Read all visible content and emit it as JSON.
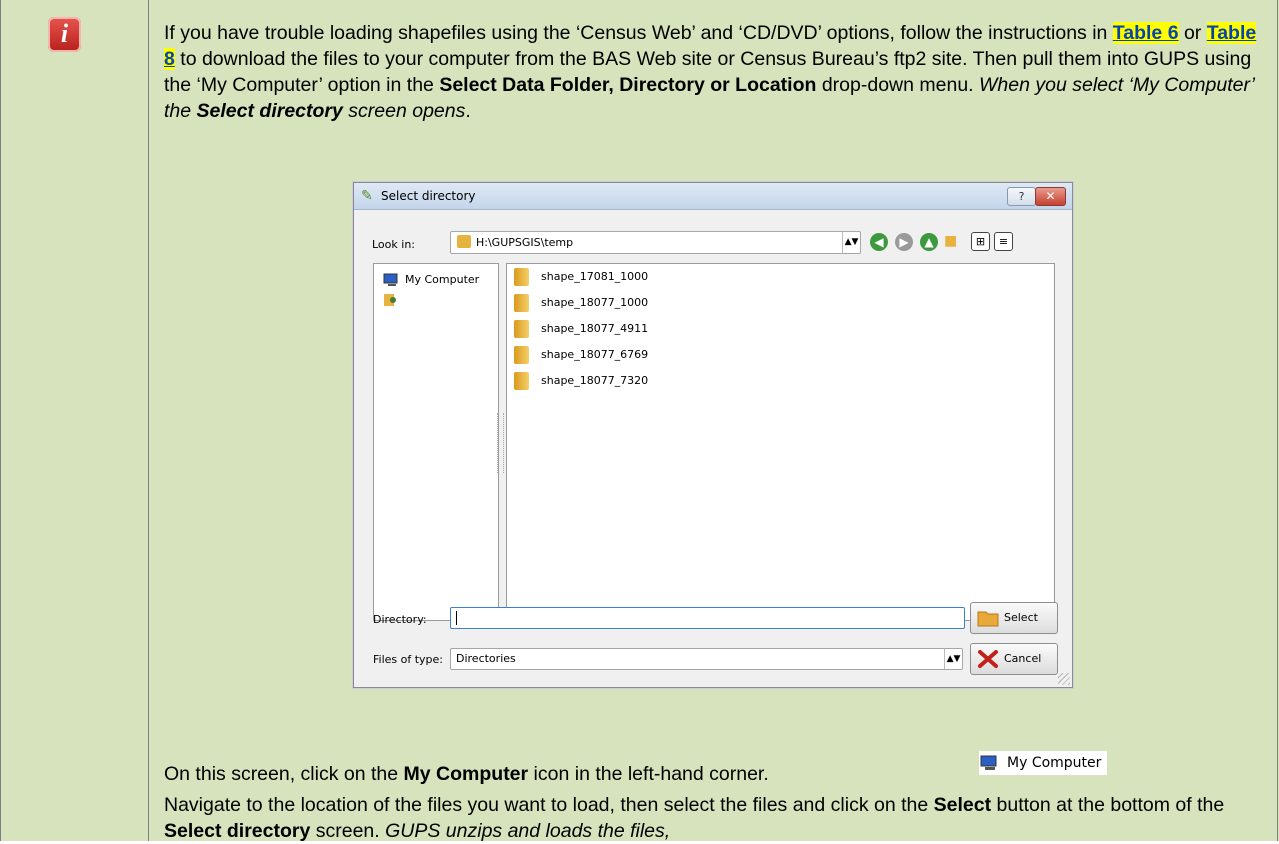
{
  "paragraph1": {
    "s1": "If you have trouble loading shapefiles using the ‘Census Web’ and ‘CD/DVD’ options, follow the instructions in ",
    "link1": "Table 6",
    "s2": " or ",
    "link2": "Table 8",
    "s3": " to download the files to your computer from the BAS Web site or Census Bureau’s ftp2 site. Then pull them into GUPS using the ‘My Computer’ option in the ",
    "b1": "Select Data Folder, Directory or Location",
    "s4": " drop-down menu. ",
    "i1": "When you select ‘My Computer’ the ",
    "ib1": "Select directory",
    "i2": " screen opens",
    "s5": "."
  },
  "dialog": {
    "title": "Select directory",
    "help_label": "?",
    "close_label": "✕",
    "lookin_label": "Look in:",
    "lookin_value": "H:\\GUPSGIS\\temp",
    "sidebar": [
      {
        "label": "My Computer"
      },
      {
        "label": ""
      }
    ],
    "files": [
      "shape_17081_1000",
      "shape_18077_1000",
      "shape_18077_4911",
      "shape_18077_6769",
      "shape_18077_7320"
    ],
    "directory_label": "Directory:",
    "directory_value": "",
    "types_label": "Files of type:",
    "types_value": "Directories",
    "select_label": "Select",
    "cancel_label": "Cancel"
  },
  "paragraph2": {
    "s1": "On this screen, click on the ",
    "b1": "My Computer",
    "s2": " icon in the left-hand corner.",
    "icon_label": "My Computer"
  },
  "paragraph3": {
    "s1": "Navigate to the location of the files you want to load, then select the files and click on the ",
    "b1": "Select",
    "s2": " button at the bottom of the ",
    "b2": "Select directory",
    "s3": " screen. ",
    "i1": "GUPS unzips and loads the files,"
  },
  "colors": {
    "background": "#d6e3bc",
    "link_highlight": "#ffff00",
    "info_icon": "#c9322a"
  }
}
